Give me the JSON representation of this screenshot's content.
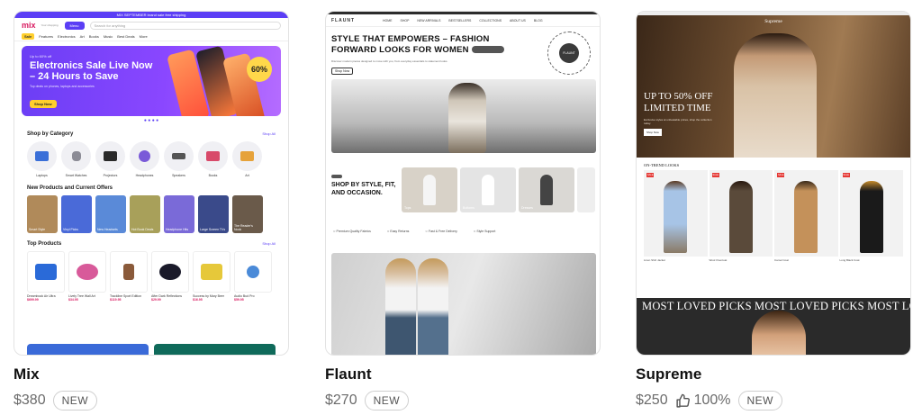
{
  "listings": [
    {
      "name": "Mix",
      "price": "$380",
      "badge": "NEW",
      "preview": {
        "topbar": "MIX SEPTEMBER brand sale free shipping",
        "logo": "mix",
        "logo_sub": "Your shopping",
        "menu_button": "Menu",
        "search_placeholder": "Search for anything",
        "nav": [
          "Sale",
          "Features",
          "Electronics",
          "Art",
          "Books",
          "Music",
          "Best Deals",
          "More"
        ],
        "hero_tag": "Up to 60% off",
        "hero_title": "Electronics Sale Live Now – 24 Hours to Save",
        "hero_sub": "Top deals on phones, laptops and accessories",
        "hero_button": "Shop Now",
        "hero_circle": "60%",
        "sections": {
          "categories": "Shop by Category",
          "offers": "New Products and Current Offers",
          "top": "Top Products",
          "view_all": "Shop All"
        },
        "categories": [
          "Laptops",
          "Smart Watches",
          "Projectors",
          "Headphones",
          "Speakers",
          "Books",
          "Art",
          "Vinyl"
        ],
        "offers": [
          "Smart Style",
          "Vinyl Picks",
          "New Headsets",
          "Hot Book Deals",
          "Headphone Hits",
          "Large Screen TVs",
          "The Reader's Nook",
          "Tech Deals"
        ],
        "products": [
          {
            "name": "Dreambook Air Ultra",
            "price": "$699.99"
          },
          {
            "name": "Lively Tree Wall Art",
            "price": "$34.95"
          },
          {
            "name": "Trackline Sport Edition",
            "price": "$119.95"
          },
          {
            "name": "After Dark Reflections",
            "price": "$29.99"
          },
          {
            "name": "Success by Mary Beer",
            "price": "$16.95"
          },
          {
            "name": "Audio Bud Pro",
            "price": "$59.95"
          }
        ]
      }
    },
    {
      "name": "Flaunt",
      "price": "$270",
      "badge": "NEW",
      "preview": {
        "logo": "FLAUNT",
        "nav": [
          "HOME",
          "SHOP",
          "NEW ARRIVALS",
          "BESTSELLERS",
          "COLLECTIONS",
          "ABOUT US",
          "BLOG"
        ],
        "hero_title": "STYLE THAT EMPOWERS – FASHION FORWARD LOOKS FOR WOMEN",
        "hero_sub": "Discover modern pieces designed to move with you, from everyday essentials to statement looks.",
        "hero_button": "Shop Now",
        "seal_text": "FLAUNT",
        "seal_ring": "STYLE • EMPOWER • FLAUNT",
        "shop_title": "SHOP BY STYLE, FIT, AND OCCASION.",
        "tiles": [
          "Tops",
          "Bottoms",
          "Dresses",
          "Outerwear"
        ],
        "features": [
          "Premium Quality Fabrics",
          "Easy Returns",
          "Fast & Free Delivery",
          "Style Support"
        ]
      }
    },
    {
      "name": "Supreme",
      "price": "$250",
      "rating": "100%",
      "badge": "NEW",
      "preview": {
        "logo": "Supreme",
        "hero_title": "UP TO 50% OFF LIMITED TIME",
        "hero_sub": "Exclusive styles at unbeatable prices, shop the collection today.",
        "hero_button": "Shop Now",
        "section": "ON-TREND LOOKS",
        "items": [
          "Linen Shirt Jacket",
          "Wool Overcoat",
          "Camel Coat",
          "Long Black Coat"
        ],
        "loved": "MOST LOVED PICKS  MOST LOVED PICKS  MOST LOVED PICKS"
      }
    }
  ],
  "colors": {
    "mix_accent": "#5b3ef5",
    "mix_sale": "#ffcf2d",
    "supreme_sale": "#e53935"
  },
  "icons": {
    "rating": "thumbs-up-icon"
  }
}
